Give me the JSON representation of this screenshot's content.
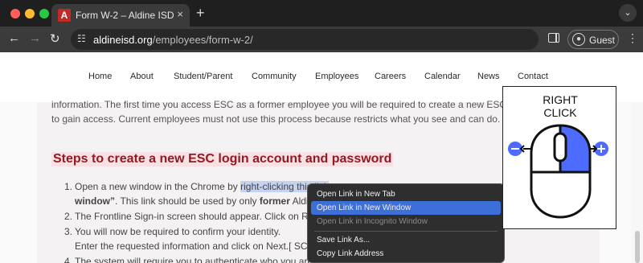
{
  "browser": {
    "tab": {
      "title": "Form W-2 – Aldine ISD",
      "favicon_letter": "A",
      "close_glyph": "×"
    },
    "new_tab_glyph": "+",
    "url": {
      "host": "aldineisd.org",
      "path": "/employees/form-w-2/"
    },
    "profile_label": "Guest",
    "icons": {
      "back": "←",
      "forward": "→",
      "reload": "↻",
      "site_info": "☷",
      "menu": "⋮",
      "tab_menu": "⌄"
    }
  },
  "site_nav": [
    "Home",
    "About",
    "Student/Parent",
    "Community",
    "Employees",
    "Careers",
    "Calendar",
    "News",
    "Contact"
  ],
  "content": {
    "intro_line1": "information. The first time you access ESC as a former employee you will be required to create a new ESC accou",
    "intro_line2": "to gain access. Current employees must not use this process because restricts what you see and can do.",
    "heading": "Steps to create a new ESC login account and password",
    "steps": [
      {
        "num": "1.",
        "pre": "Open a new window in the Chrome by ",
        "link": "right-clicking this link",
        "post": "",
        "line2_bold": "window”",
        "line2_rest": ". This link should be used by only ",
        "line2_bold2": "former",
        "line2_tail": " Aldine"
      },
      {
        "num": "2.",
        "text": "The Frontline Sign-in screen should appear. Click on Reg"
      },
      {
        "num": "3.",
        "text": "You will now be required to confirm your identity.",
        "line2": "Enter the requested information and click on Next.[ SCRE"
      },
      {
        "num": "4.",
        "text": "The system will require you to authenticate who you are"
      }
    ]
  },
  "context_menu": {
    "items": [
      {
        "label": "Open Link in New Tab",
        "state": "normal"
      },
      {
        "label": "Open Link in New Window",
        "state": "selected"
      },
      {
        "label": "Open Link in Incognito Window",
        "state": "disabled"
      },
      {
        "label": "Save Link As...",
        "state": "normal"
      },
      {
        "label": "Copy Link Address",
        "state": "normal"
      }
    ]
  },
  "callout": {
    "line1": "RIGHT",
    "line2": "CLICK",
    "icon": "mouse-right-click-icon"
  },
  "colors": {
    "accent_red": "#8e1c22",
    "highlight": "#c6d2f2",
    "menu_selected": "#3d6fd9",
    "mouse_button_fill": "#4d6bff"
  }
}
